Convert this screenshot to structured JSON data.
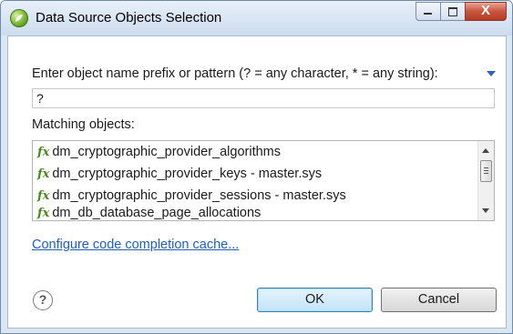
{
  "window": {
    "title": "Data Source Objects Selection",
    "close_glyph": "X",
    "accent": "#2a64c4"
  },
  "form": {
    "prompt": "Enter object name prefix or pattern (? = any character, * = any string):",
    "pattern_value": "?",
    "matching_label": "Matching objects:"
  },
  "list": {
    "icon_glyph": "fx",
    "items": [
      {
        "label": "dm_cryptographic_provider_algorithms"
      },
      {
        "label": "dm_cryptographic_provider_keys - master.sys"
      },
      {
        "label": "dm_cryptographic_provider_sessions - master.sys"
      },
      {
        "label": "dm_db_database_page_allocations"
      }
    ]
  },
  "footer": {
    "link": "Configure code completion cache...",
    "help_glyph": "?",
    "ok_label": "OK",
    "cancel_label": "Cancel"
  }
}
